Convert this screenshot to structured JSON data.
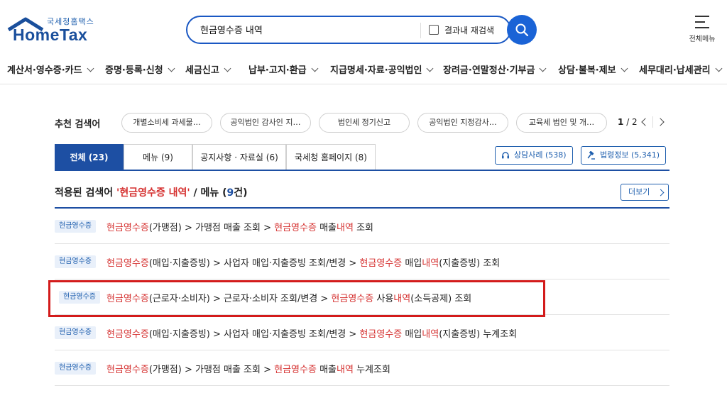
{
  "header": {
    "logo_sub": "국세청홈택스",
    "logo_main": "HomeTax",
    "search_value": "현금영수증 내역",
    "research_label": "결과내 재검색",
    "all_menu_label": "전체메뉴"
  },
  "nav": [
    {
      "label": "계산서·영수증·카드"
    },
    {
      "label": "증명·등록·신청"
    },
    {
      "label": "세금신고"
    },
    {
      "label": "납부·고지·환급"
    },
    {
      "label": "지급명세·자료·공익법인"
    },
    {
      "label": "장려금·연말정산·기부금"
    },
    {
      "label": "상담·불복·제보"
    },
    {
      "label": "세무대리·납세관리"
    }
  ],
  "recommended": {
    "title": "추천 검색어",
    "items": [
      "개별소비세 과세물…",
      "공익법인 감사인 지…",
      "법인세 정기신고",
      "공익법인 지정감사…",
      "교육세 법인 및 개…"
    ],
    "page_current": "1",
    "page_total": "/ 2"
  },
  "tabs": [
    {
      "label": "전체 (23)"
    },
    {
      "label": "메뉴 (9)"
    },
    {
      "label": "공지사항 · 자료실 (6)"
    },
    {
      "label": "국세청 홈페이지 (8)"
    }
  ],
  "side_buttons": {
    "consult": "상담사례 (538)",
    "law": "법령정보 (5,341)"
  },
  "results": {
    "head_prefix": "적용된 검색어 ",
    "head_keyword": "'현금영수증 내역'",
    "head_mid": " / 메뉴 (",
    "head_count": "9",
    "head_suffix": "건)",
    "more_label": "더보기",
    "badge": "현금영수증",
    "rows": [
      {
        "p1": "현금영수증",
        "p2": "(가맹점) > 가맹점 매출 조회 > ",
        "p3": "현금영수증",
        "p4": " 매출",
        "p5": "내역",
        "p6": " 조회"
      },
      {
        "p1": "현금영수증",
        "p2": "(매입·지출증빙) > 사업자 매입·지출증빙 조회/변경 > ",
        "p3": "현금영수증",
        "p4": " 매입",
        "p5": "내역",
        "p6": "(지출증빙) 조회"
      },
      {
        "p1": "현금영수증",
        "p2": "(근로자·소비자) > 근로자·소비자 조회/변경 > ",
        "p3": "현금영수증",
        "p4": " 사용",
        "p5": "내역",
        "p6": "(소득공제) 조회"
      },
      {
        "p1": "현금영수증",
        "p2": "(매입·지출증빙) > 사업자 매입·지출증빙 조회/변경 > ",
        "p3": "현금영수증",
        "p4": " 매입",
        "p5": "내역",
        "p6": "(지출증빙) 누계조회"
      },
      {
        "p1": "현금영수증",
        "p2": "(가맹점) > 가맹점 매출 조회 > ",
        "p3": "현금영수증",
        "p4": " 매출",
        "p5": "내역",
        "p6": " 누계조회"
      }
    ]
  },
  "colors": {
    "accent": "#1d4fa3",
    "highlight": "#d5302f",
    "annotation_box": "#d31b1b"
  }
}
